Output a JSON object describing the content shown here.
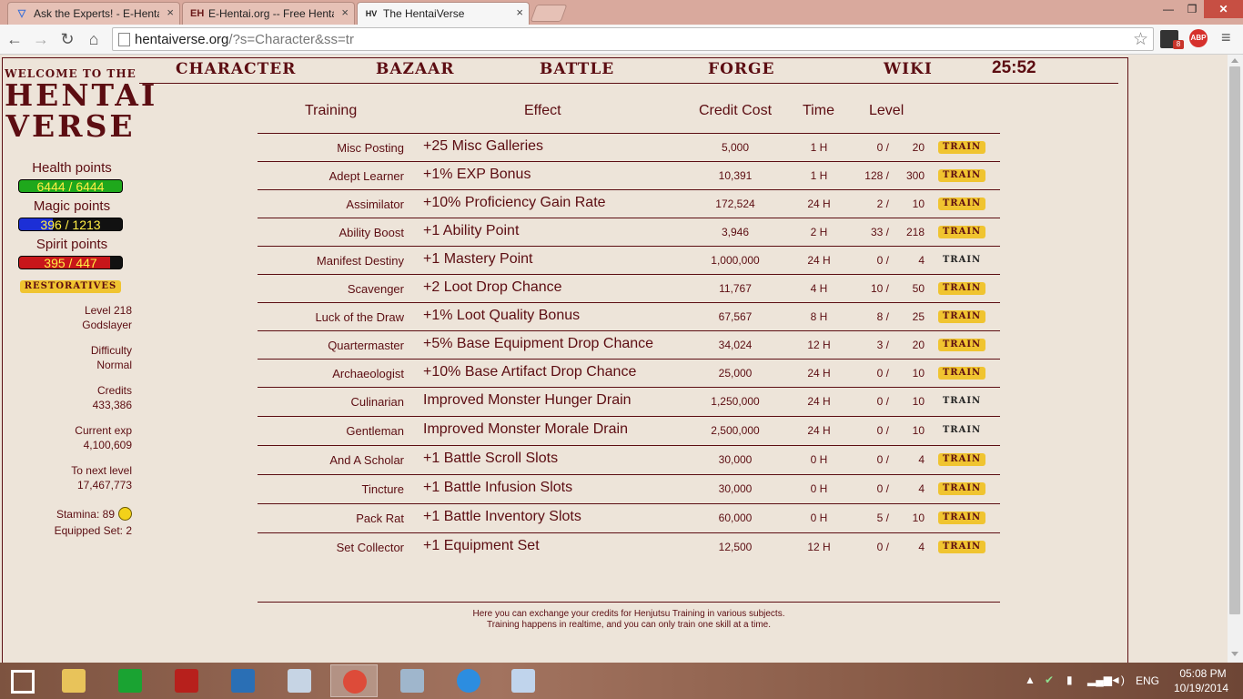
{
  "browser": {
    "tabs": [
      {
        "title": "Ask the Experts! - E-Hentai",
        "favicon": "eh-forum-icon",
        "close": "×"
      },
      {
        "title": "E-Hentai.org -- Free Hentai",
        "favicon": "eh-icon",
        "favicon_text": "EH",
        "close": "×"
      },
      {
        "title": "The HentaiVerse",
        "favicon": "hv-icon",
        "favicon_text": "HV",
        "close": "×",
        "active": true
      }
    ],
    "url_host": "hentaiverse.org",
    "url_path": "/?s=Character&ss=tr",
    "extension_badge": "8",
    "abp_label": "ABP",
    "window_controls": {
      "minimize": "—",
      "maximize": "❐",
      "close": "✕"
    }
  },
  "sidebar": {
    "logo_small": "WELCOME TO THE",
    "logo_line1": "HENTAI",
    "logo_line2": "VERSE",
    "bars": [
      {
        "label": "Health points",
        "text": "6444 / 6444",
        "fill": 1.0,
        "color": "#1fa81c"
      },
      {
        "label": "Magic points",
        "text": "396 / 1213",
        "fill": 0.326,
        "color": "#1c2fd6"
      },
      {
        "label": "Spirit points",
        "text": "395 / 447",
        "fill": 0.884,
        "color": "#c8161a"
      }
    ],
    "restoratives": "RESTORATIVES",
    "level": "Level 218",
    "title": "Godslayer",
    "difficulty_label": "Difficulty",
    "difficulty": "Normal",
    "credits_label": "Credits",
    "credits": "433,386",
    "exp_label": "Current exp",
    "exp": "4,100,609",
    "next_label": "To next level",
    "next": "17,467,773",
    "stamina": "Stamina: 89",
    "equipped_set": "Equipped Set: 2"
  },
  "nav": {
    "character": "CHARACTER",
    "bazaar": "BAZAAR",
    "battle": "BATTLE",
    "forge": "FORGE",
    "wiki": "WIKI",
    "timer": "25:52"
  },
  "table": {
    "headers": {
      "training": "Training",
      "effect": "Effect",
      "cost": "Credit Cost",
      "time": "Time",
      "level": "Level"
    },
    "rows": [
      {
        "name": "Misc Posting",
        "effect": "+25 Misc Galleries",
        "cost": "5,000",
        "time": "1 H",
        "cur": "0 /",
        "max": "20",
        "train": "TRAIN",
        "available": true
      },
      {
        "name": "Adept Learner",
        "effect": "+1% EXP Bonus",
        "cost": "10,391",
        "time": "1 H",
        "cur": "128 /",
        "max": "300",
        "train": "TRAIN",
        "available": true
      },
      {
        "name": "Assimilator",
        "effect": "+10% Proficiency Gain Rate",
        "cost": "172,524",
        "time": "24 H",
        "cur": "2 /",
        "max": "10",
        "train": "TRAIN",
        "available": true
      },
      {
        "name": "Ability Boost",
        "effect": "+1 Ability Point",
        "cost": "3,946",
        "time": "2 H",
        "cur": "33 /",
        "max": "218",
        "train": "TRAIN",
        "available": true
      },
      {
        "name": "Manifest Destiny",
        "effect": "+1 Mastery Point",
        "cost": "1,000,000",
        "time": "24 H",
        "cur": "0 /",
        "max": "4",
        "train": "TRAIN",
        "available": false
      },
      {
        "name": "Scavenger",
        "effect": "+2 Loot Drop Chance",
        "cost": "11,767",
        "time": "4 H",
        "cur": "10 /",
        "max": "50",
        "train": "TRAIN",
        "available": true
      },
      {
        "name": "Luck of the Draw",
        "effect": "+1% Loot Quality Bonus",
        "cost": "67,567",
        "time": "8 H",
        "cur": "8 /",
        "max": "25",
        "train": "TRAIN",
        "available": true
      },
      {
        "name": "Quartermaster",
        "effect": "+5% Base Equipment Drop Chance",
        "cost": "34,024",
        "time": "12 H",
        "cur": "3 /",
        "max": "20",
        "train": "TRAIN",
        "available": true
      },
      {
        "name": "Archaeologist",
        "effect": "+10% Base Artifact Drop Chance",
        "cost": "25,000",
        "time": "24 H",
        "cur": "0 /",
        "max": "10",
        "train": "TRAIN",
        "available": true
      },
      {
        "name": "Culinarian",
        "effect": "Improved Monster Hunger Drain",
        "cost": "1,250,000",
        "time": "24 H",
        "cur": "0 /",
        "max": "10",
        "train": "TRAIN",
        "available": false
      },
      {
        "name": "Gentleman",
        "effect": "Improved Monster Morale Drain",
        "cost": "2,500,000",
        "time": "24 H",
        "cur": "0 /",
        "max": "10",
        "train": "TRAIN",
        "available": false
      },
      {
        "name": "And A Scholar",
        "effect": "+1 Battle Scroll Slots",
        "cost": "30,000",
        "time": "0 H",
        "cur": "0 /",
        "max": "4",
        "train": "TRAIN",
        "available": true
      },
      {
        "name": "Tincture",
        "effect": "+1 Battle Infusion Slots",
        "cost": "30,000",
        "time": "0 H",
        "cur": "0 /",
        "max": "4",
        "train": "TRAIN",
        "available": true
      },
      {
        "name": "Pack Rat",
        "effect": "+1 Battle Inventory Slots",
        "cost": "60,000",
        "time": "0 H",
        "cur": "5 /",
        "max": "10",
        "train": "TRAIN",
        "available": true
      },
      {
        "name": "Set Collector",
        "effect": "+1 Equipment Set",
        "cost": "12,500",
        "time": "12 H",
        "cur": "0 /",
        "max": "4",
        "train": "TRAIN",
        "available": true
      }
    ],
    "footer_line1": "Here you can exchange your credits for Henjutsu Training in various subjects.",
    "footer_line2": "Training happens in realtime, and you can only train one skill at a time."
  },
  "taskbar": {
    "apps": [
      "start-icon",
      "file-explorer-icon",
      "store-icon",
      "power-icon",
      "settings-icon",
      "monitor-icon",
      "chrome-icon",
      "calculator-icon",
      "internet-explorer-icon",
      "paint-icon"
    ],
    "active_app": "chrome-icon",
    "lang": "ENG",
    "time": "05:08 PM",
    "date": "10/19/2014"
  }
}
